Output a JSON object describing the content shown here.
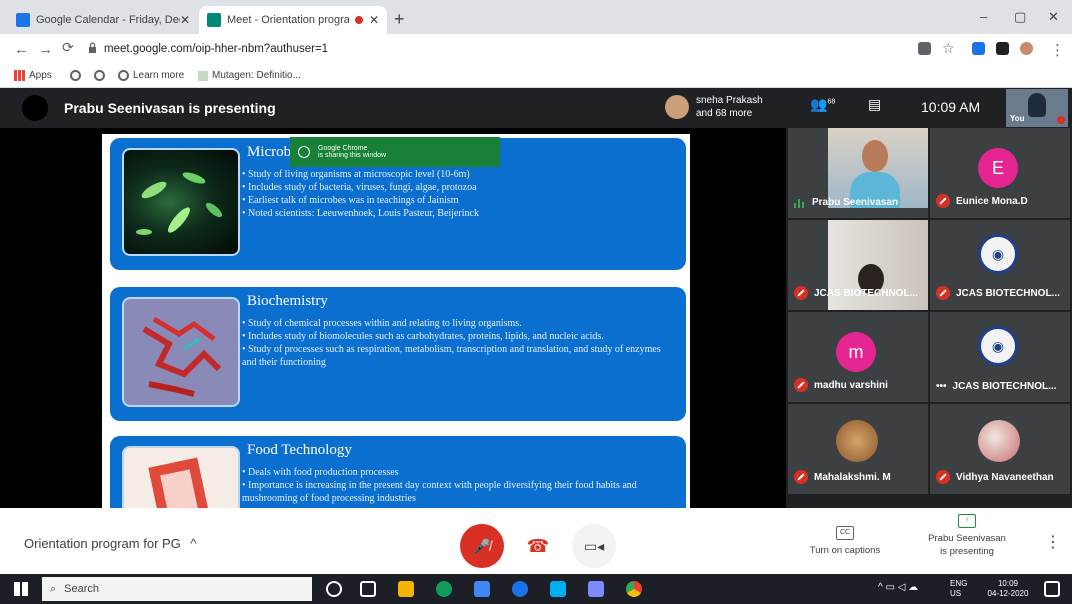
{
  "browser": {
    "tabs": [
      {
        "title": "Google Calendar - Friday, Decem",
        "fav_color": "#1a73e8",
        "active": false
      },
      {
        "title": "Meet - Orientation program",
        "fav_color": "#00897b",
        "active": true
      }
    ],
    "new_tab": "+",
    "window_controls": {
      "minimize": "–",
      "maximize": "▢",
      "close": "✕"
    },
    "url": "meet.google.com/oip-hher-nbm?authuser=1",
    "bookmarks": [
      "Apps",
      "Learn more",
      "Mutagen: Definitio..."
    ]
  },
  "meet": {
    "presenting_title": "Prabu Seenivasan is presenting",
    "people": {
      "line1": "sneha Prakash",
      "line2": "and 68 more"
    },
    "participants_count": "68",
    "time": "10:09 AM",
    "self_label": "You",
    "meeting_name": "Orientation program for PG",
    "meeting_chevron": "^",
    "captions_label": "Turn on captions",
    "captions_icon": "CC",
    "presenting_action_line1": "Prabu Seenivasan",
    "presenting_action_line2": "is presenting"
  },
  "notice": {
    "line1": "Google Chrome",
    "line2": "is sharing this window"
  },
  "slide": {
    "sections": [
      {
        "title": "Microb",
        "bullets": [
          "Study of living organisms at microscopic level (10-6m)",
          "Includes study of bacteria, viruses, fungi, algae, protozoa",
          "Earliest talk of microbes was in teachings of Jainism",
          "Noted scientists: Leeuwenhoek, Louis Pasteur, Beijerinck"
        ]
      },
      {
        "title": "Biochemistry",
        "bullets": [
          "Study of chemical processes within and relating to living organisms.",
          "Includes study of biomolecules such as carbohydrates, proteins, lipids, and nucleic acids.",
          "Study of processes such as respiration, metabolism, transcription and translation, and study of enzymes and their functioning"
        ]
      },
      {
        "title": "Food Technology",
        "bullets": [
          "Deals with food production processes",
          "Importance is increasing in the present day context with people diversifying their food habits and mushrooming of food processing industries"
        ]
      }
    ]
  },
  "participants": [
    {
      "name": "Prabu Seenivasan",
      "status": "speaking",
      "type": "video"
    },
    {
      "name": "Eunice Mona.D",
      "status": "muted",
      "type": "letter",
      "letter": "E",
      "color": "#e52592"
    },
    {
      "name": "JCAS BIOTECHNOL...",
      "status": "muted",
      "type": "video"
    },
    {
      "name": "JCAS BIOTECHNOL...",
      "status": "muted",
      "type": "logo"
    },
    {
      "name": "madhu varshini",
      "status": "muted",
      "type": "letter",
      "letter": "m",
      "color": "#e52592"
    },
    {
      "name": "JCAS BIOTECHNOL...",
      "status": "more",
      "type": "logo"
    },
    {
      "name": "Mahalakshmi. M",
      "status": "muted",
      "type": "photo"
    },
    {
      "name": "Vidhya Navaneethan",
      "status": "muted",
      "type": "photo"
    }
  ],
  "taskbar": {
    "search_placeholder": "Search",
    "lang1": "ENG",
    "lang2": "US",
    "time": "10:09",
    "date": "04-12-2020"
  }
}
